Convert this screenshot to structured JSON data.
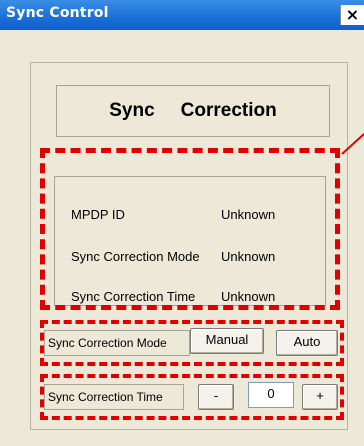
{
  "window": {
    "title": "Sync  Control",
    "close_glyph": "×"
  },
  "heading": {
    "word1": "Sync",
    "word2": "Correction"
  },
  "info": {
    "rows": [
      {
        "label": "MPDP ID",
        "value": "Unknown"
      },
      {
        "label": "Sync Correction Mode",
        "value": "Unknown"
      },
      {
        "label": "Sync Correction Time",
        "value": "Unknown"
      }
    ]
  },
  "mode_control": {
    "label": "Sync Correction Mode",
    "manual_label": "Manual",
    "auto_label": "Auto"
  },
  "time_control": {
    "label": "Sync Correction Time",
    "minus_label": "-",
    "value": "0",
    "plus_label": "+"
  },
  "colors": {
    "titlebar": "#1a6fd6",
    "highlight": "#e00000",
    "background": "#ece9d8"
  }
}
